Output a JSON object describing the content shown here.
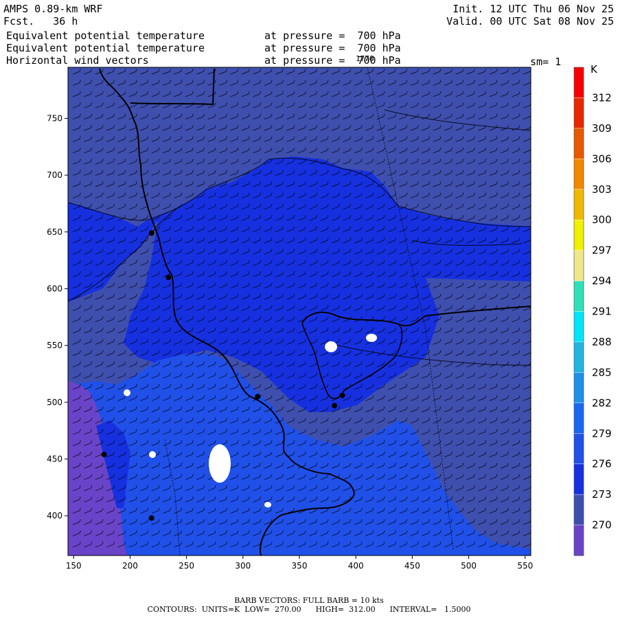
{
  "header": {
    "model": "AMPS 0.89-km WRF",
    "fcst_label": "Fcst.",
    "fcst_value": "36 h",
    "init": "Init. 12 UTC Thu 06 Nov 25",
    "valid": "Valid. 00 UTC Sat 08 Nov 25",
    "fields": [
      {
        "name": "Equivalent potential temperature",
        "level": "at pressure =  700 hPa"
      },
      {
        "name": "Equivalent potential temperature",
        "level": "at pressure =  700 hPa"
      },
      {
        "name": "Horizontal wind vectors",
        "level": "at pressure =  700 hPa"
      }
    ],
    "sm": "sm= 1",
    "overlap_label": "1770"
  },
  "footer": {
    "barb": "BARB VECTORS:  FULL BARB = 10 kts",
    "contours": "CONTOURS:  UNITS=K  LOW=  270.00      HIGH=  312.00      INTERVAL=   1.5000"
  },
  "chart_data": {
    "type": "heatmap",
    "title": "Equivalent potential temperature at 700 hPa",
    "xlim": [
      145,
      555
    ],
    "ylim": [
      365,
      795
    ],
    "x_ticks": [
      150,
      200,
      250,
      300,
      350,
      400,
      450,
      500,
      550
    ],
    "y_ticks": [
      400,
      450,
      500,
      550,
      600,
      650,
      700,
      750
    ],
    "colorbar": {
      "unit": "K",
      "labels": [
        270,
        273,
        276,
        279,
        282,
        285,
        288,
        291,
        294,
        297,
        300,
        303,
        306,
        309,
        312
      ],
      "colors": [
        "#6a44c8",
        "#3f4fae",
        "#1630e0",
        "#2050e8",
        "#1a68f0",
        "#1e90e8",
        "#22b4de",
        "#00e6f8",
        "#30e0b8",
        "#f0e68c",
        "#f0f000",
        "#f0b800",
        "#f08800",
        "#e85a00",
        "#e82800",
        "#f80000"
      ]
    },
    "regions": [
      {
        "name": "273",
        "color": "#3f4fae"
      },
      {
        "name": "276",
        "color": "#1630e0"
      },
      {
        "name": "279",
        "color": "#2050e8"
      },
      {
        "name": "270",
        "color": "#6a44c8"
      }
    ],
    "stations": [
      {
        "x": 219,
        "y": 649
      },
      {
        "x": 234,
        "y": 610
      },
      {
        "x": 313,
        "y": 505
      },
      {
        "x": 381,
        "y": 497
      },
      {
        "x": 388,
        "y": 506
      },
      {
        "x": 177,
        "y": 454
      },
      {
        "x": 219,
        "y": 398
      }
    ],
    "grid": false
  }
}
